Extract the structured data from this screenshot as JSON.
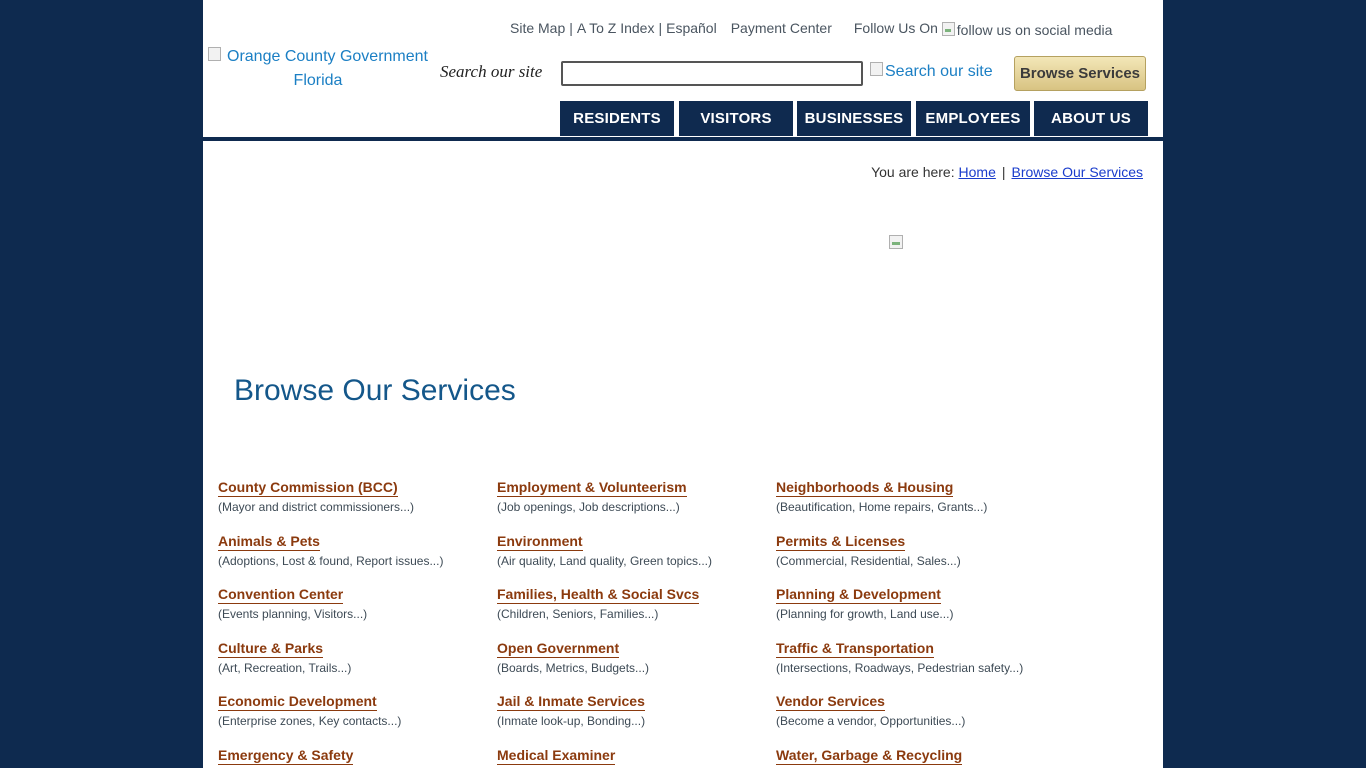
{
  "utility": {
    "site_map": "Site Map",
    "a_to_z": "A To Z Index",
    "espanol": "Español",
    "payment_center": "Payment Center",
    "follow_us": "Follow Us On",
    "follow_alt": "follow us on social media",
    "separator": "|"
  },
  "logo": {
    "line1": "Orange County Government",
    "line2": "Florida"
  },
  "search": {
    "label": "Search our site",
    "value": "",
    "button_alt": "Search our site",
    "browse_button": "Browse Services"
  },
  "nav": {
    "items": [
      "RESIDENTS",
      "VISITORS",
      "BUSINESSES",
      "EMPLOYEES",
      "ABOUT US"
    ]
  },
  "breadcrumb": {
    "prefix": "You are here:",
    "home": "Home",
    "separator": "|",
    "current": "Browse Our Services"
  },
  "page_title": "Browse Our Services",
  "services": [
    {
      "label": "County Commission (BCC)",
      "desc": "(Mayor and district commissioners...)"
    },
    {
      "label": "Employment & Volunteerism",
      "desc": "(Job openings, Job descriptions...)"
    },
    {
      "label": "Neighborhoods & Housing",
      "desc": "(Beautification, Home repairs, Grants...)"
    },
    {
      "label": "Animals & Pets",
      "desc": "(Adoptions, Lost & found, Report issues...)"
    },
    {
      "label": "Environment",
      "desc": "(Air quality, Land quality, Green topics...)"
    },
    {
      "label": "Permits & Licenses",
      "desc": "(Commercial, Residential, Sales...)"
    },
    {
      "label": "Convention Center",
      "desc": "(Events planning, Visitors...)"
    },
    {
      "label": "Families, Health & Social Svcs",
      "desc": "(Children, Seniors, Families...)"
    },
    {
      "label": "Planning & Development",
      "desc": "(Planning for growth, Land use...)"
    },
    {
      "label": "Culture & Parks",
      "desc": "(Art, Recreation, Trails...)"
    },
    {
      "label": "Open Government",
      "desc": "(Boards, Metrics, Budgets...)"
    },
    {
      "label": "Traffic & Transportation",
      "desc": "(Intersections, Roadways, Pedestrian safety...)"
    },
    {
      "label": "Economic Development",
      "desc": "(Enterprise zones, Key contacts...)"
    },
    {
      "label": "Jail & Inmate Services",
      "desc": "(Inmate look-up, Bonding...)"
    },
    {
      "label": "Vendor Services",
      "desc": "(Become a vendor, Opportunities...)"
    },
    {
      "label": "Emergency & Safety",
      "desc": ""
    },
    {
      "label": "Medical Examiner",
      "desc": ""
    },
    {
      "label": "Water, Garbage & Recycling",
      "desc": ""
    }
  ],
  "colors": {
    "background": "#0e2a4f",
    "nav": "#0f2a4f",
    "link": "#8b3a0e",
    "title": "#14578a",
    "logo": "#1b7fc4"
  }
}
